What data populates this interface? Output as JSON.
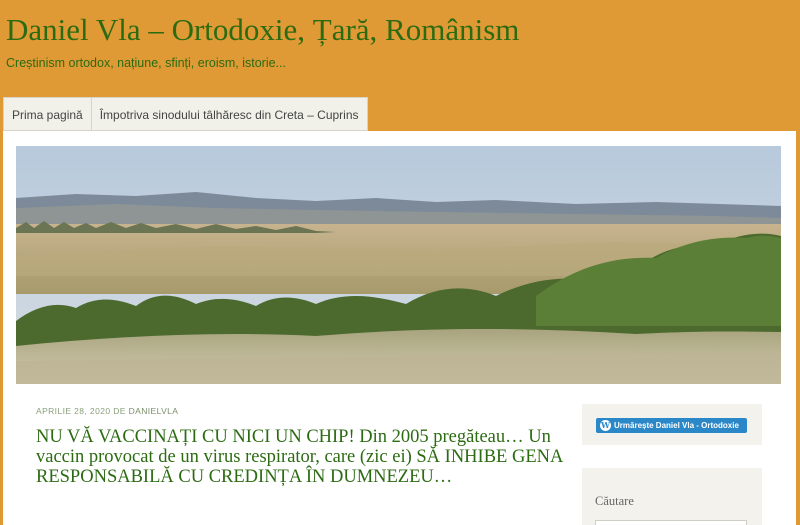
{
  "header": {
    "site_title": "Daniel Vla – Ortodoxie, Țară, Românism",
    "site_description": "Creștinism ortodox, națiune, sfinți, eroism, istorie..."
  },
  "nav": {
    "items": [
      {
        "label": "Prima pagină"
      },
      {
        "label": "Împotriva sinodului tâlhăresc din Creta – Cuprins"
      }
    ]
  },
  "post": {
    "date": "APRILIE 28, 2020",
    "by": "DE",
    "author": "DANIELVLA",
    "title": "NU VĂ VACCINAȚI CU NICI UN CHIP! Din 2005 pregăteau… Un vaccin provocat de un virus respirator, care (zic ei) SĂ INHIBE GENA RESPONSABILĂ CU CREDINȚA ÎN DUMNEZEU…"
  },
  "sidebar": {
    "follow_label": "Urmărește Daniel Vla - Ortodoxie",
    "search_title": "Căutare",
    "search_value": ""
  },
  "colors": {
    "background": "#e09a35",
    "title_green": "#2c6b12",
    "follow_blue": "#2b88c8"
  }
}
